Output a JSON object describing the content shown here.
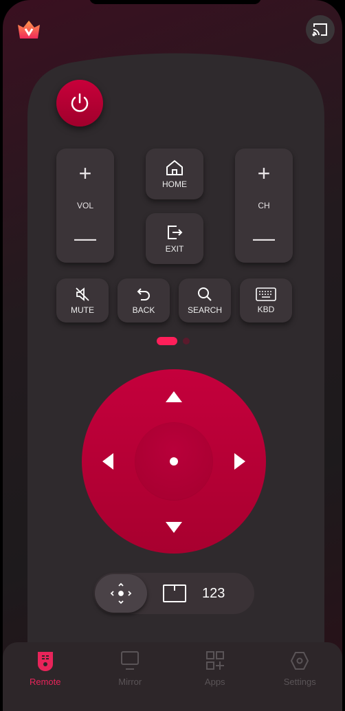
{
  "colors": {
    "accent": "#e8245a",
    "dpad": "#b8003a",
    "button": "#3b3438"
  },
  "buttons": {
    "vol": {
      "label": "VOL",
      "plus": "+",
      "minus": "—"
    },
    "ch": {
      "label": "CH",
      "plus": "+",
      "minus": "—"
    },
    "home": "HOME",
    "exit": "EXIT",
    "mute": "MUTE",
    "back": "BACK",
    "search": "SEARCH",
    "kbd": "KBD"
  },
  "bottom_bar": {
    "numpad": "123"
  },
  "tabs": [
    {
      "label": "Remote",
      "icon": "remote-icon",
      "active": true
    },
    {
      "label": "Mirror",
      "icon": "monitor-icon",
      "active": false
    },
    {
      "label": "Apps",
      "icon": "apps-icon",
      "active": false
    },
    {
      "label": "Settings",
      "icon": "settings-icon",
      "active": false
    }
  ],
  "pager": {
    "current": 1,
    "total": 2
  }
}
